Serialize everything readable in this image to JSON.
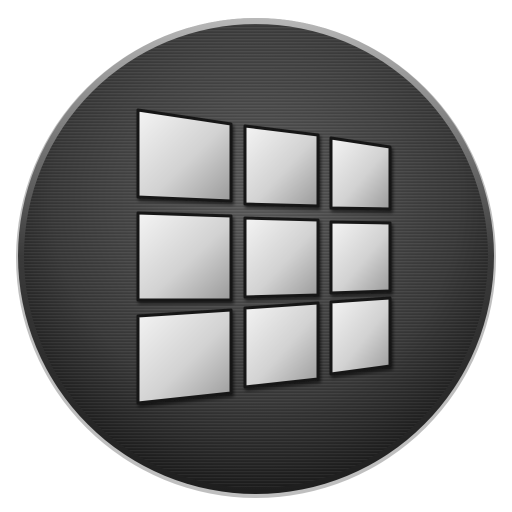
{
  "icon": {
    "name": "tiled-window-logo-icon",
    "grid": {
      "rows": 3,
      "columns": 3
    },
    "colors": {
      "disc_base": "#3a3a3a",
      "disc_dark": "#1e1e1e",
      "disc_light": "#5c5c5c",
      "rim_light": "#b8b8b8",
      "tile_light": "#f4f4f4",
      "tile_mid": "#d2d2d2",
      "tile_dark": "#9a9a9a",
      "tile_edge": "#181818",
      "background": "#ffffff"
    }
  }
}
